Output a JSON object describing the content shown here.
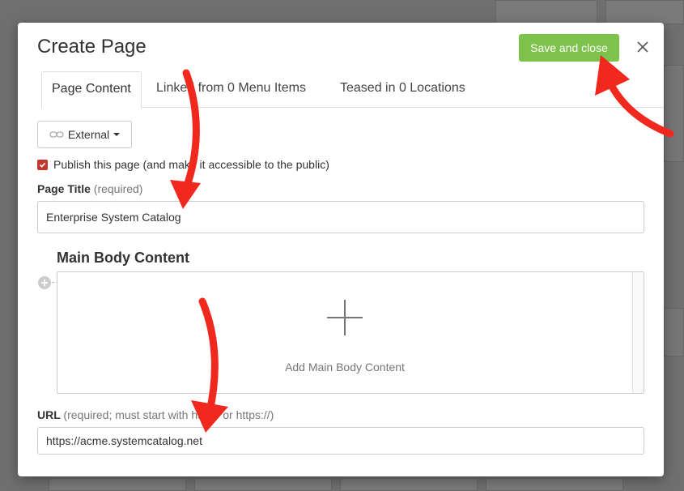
{
  "modal": {
    "title": "Create Page",
    "save_label": "Save and close",
    "tabs": [
      {
        "label": "Page Content",
        "active": true
      },
      {
        "label": "Linked from 0 Menu Items",
        "active": false
      },
      {
        "label": "Teased in 0 Locations",
        "active": false
      }
    ],
    "link_type": {
      "label": "External",
      "icon": "link-icon"
    },
    "publish": {
      "checked": true,
      "label": "Publish this page (and make it accessible to the public)"
    },
    "page_title": {
      "label": "Page Title",
      "hint": "(required)",
      "value": "Enterprise System Catalog"
    },
    "main_body": {
      "heading": "Main Body Content",
      "add_label": "Add Main Body Content"
    },
    "url": {
      "label": "URL",
      "hint": "(required; must start with http:// or https://)",
      "value": "https://acme.systemcatalog.net"
    }
  },
  "colors": {
    "save_button": "#7dc24b",
    "checkbox": "#c0392b",
    "annotation_arrow": "#f0281e"
  }
}
